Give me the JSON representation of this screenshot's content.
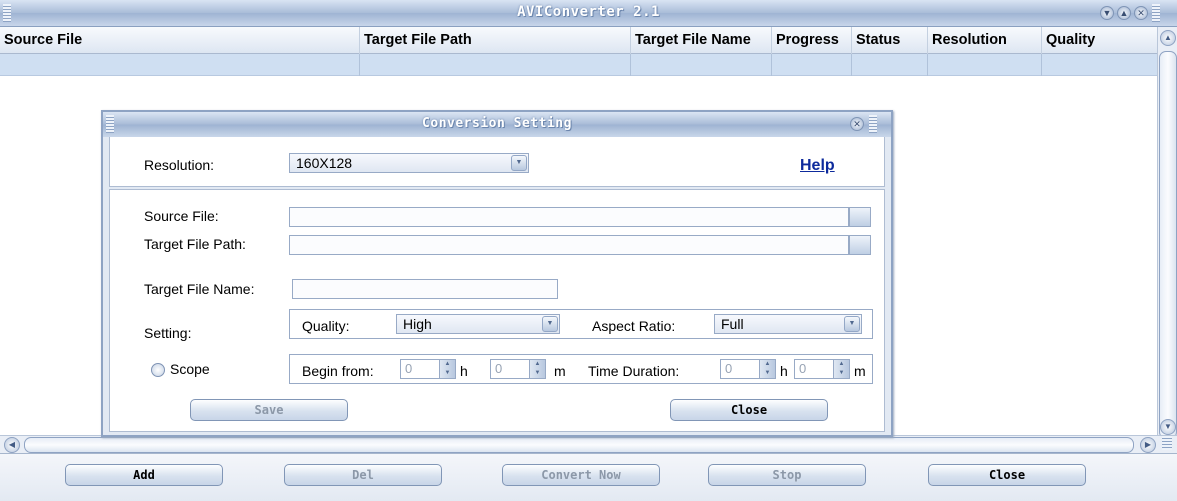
{
  "window": {
    "title": "AVIConverter 2.1",
    "controls": [
      "minimize-icon",
      "maximize-icon",
      "close-icon"
    ]
  },
  "grid": {
    "columns": [
      "Source File",
      "Target File Path",
      "Target File Name",
      "Progress",
      "Status",
      "Resolution",
      "Quality"
    ]
  },
  "toolbar": {
    "add": "Add",
    "del": "Del",
    "convert": "Convert Now",
    "stop": "Stop",
    "close": "Close"
  },
  "dialog": {
    "title": "Conversion Setting",
    "resolution_label": "Resolution:",
    "resolution_value": "160X128",
    "help": "Help",
    "source_label": "Source File:",
    "target_path_label": "Target File Path:",
    "target_name_label": "Target File Name:",
    "setting_label": "Setting:",
    "quality_label": "Quality:",
    "quality_value": "High",
    "aspect_label": "Aspect Ratio:",
    "aspect_value": "Full",
    "scope_label": "Scope",
    "begin_label": "Begin from:",
    "begin_h": "0",
    "h_unit": "h",
    "begin_m": "0",
    "m_unit": "m",
    "duration_label": "Time Duration:",
    "duration_h": "0",
    "duration_m": "0",
    "save": "Save",
    "close": "Close"
  },
  "colors": {
    "title_gradient": "#a9bcd8",
    "row_fill": "#cfdff2",
    "link": "#0d2a9c"
  }
}
